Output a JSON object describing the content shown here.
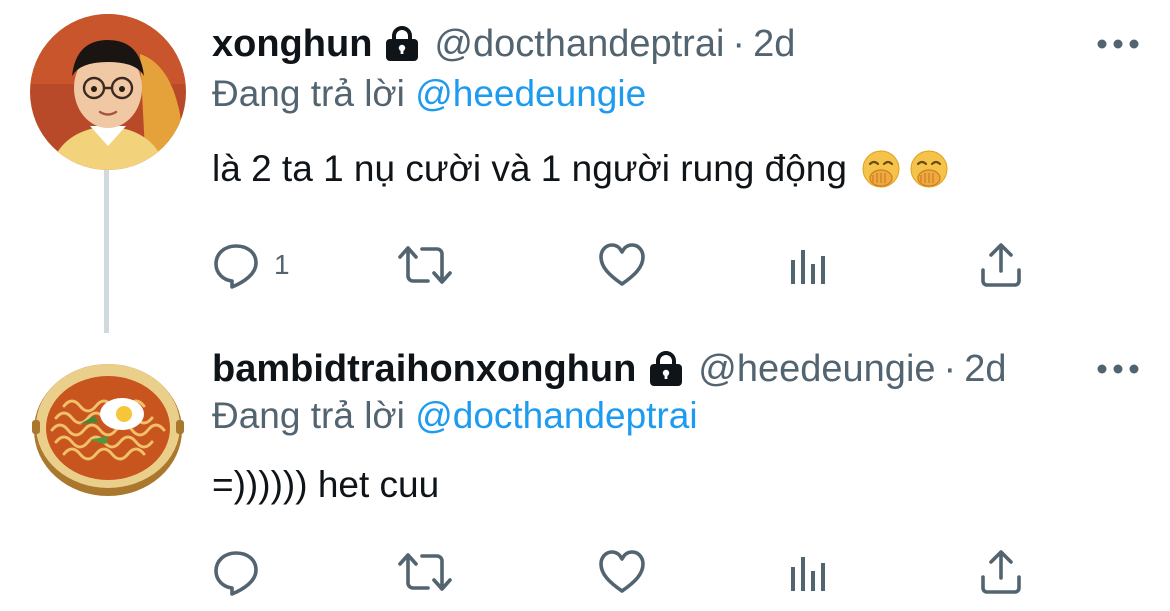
{
  "tweets": [
    {
      "display_name": "xonghun",
      "handle": "@docthandeptrai",
      "separator": "·",
      "time": "2d",
      "reply_prefix": "Đang trả lời",
      "reply_mention": "@heedeungie",
      "text": "là 2 ta 1 nụ cười và 1 người rung động",
      "emoji": [
        "face-with-hand-over-mouth",
        "face-with-hand-over-mouth"
      ],
      "reply_count": "1",
      "avatar": "boy-with-glasses-photo",
      "locked": true
    },
    {
      "display_name": "bambidtraihonxonghun",
      "handle": "@heedeungie",
      "separator": "·",
      "time": "2d",
      "reply_prefix": "Đang trả lời",
      "reply_mention": "@docthandeptrai",
      "text": "=)))))) het cuu",
      "emoji": [],
      "reply_count": "",
      "avatar": "ramen-bowl-illustration",
      "locked": true
    }
  ],
  "colors": {
    "text": "#0f1419",
    "secondary": "#536471",
    "link": "#1d9bf0",
    "thread_line": "#cfd9de"
  },
  "icons": [
    "lock-icon",
    "more-icon",
    "reply-icon",
    "retweet-icon",
    "like-icon",
    "views-icon",
    "share-icon"
  ]
}
